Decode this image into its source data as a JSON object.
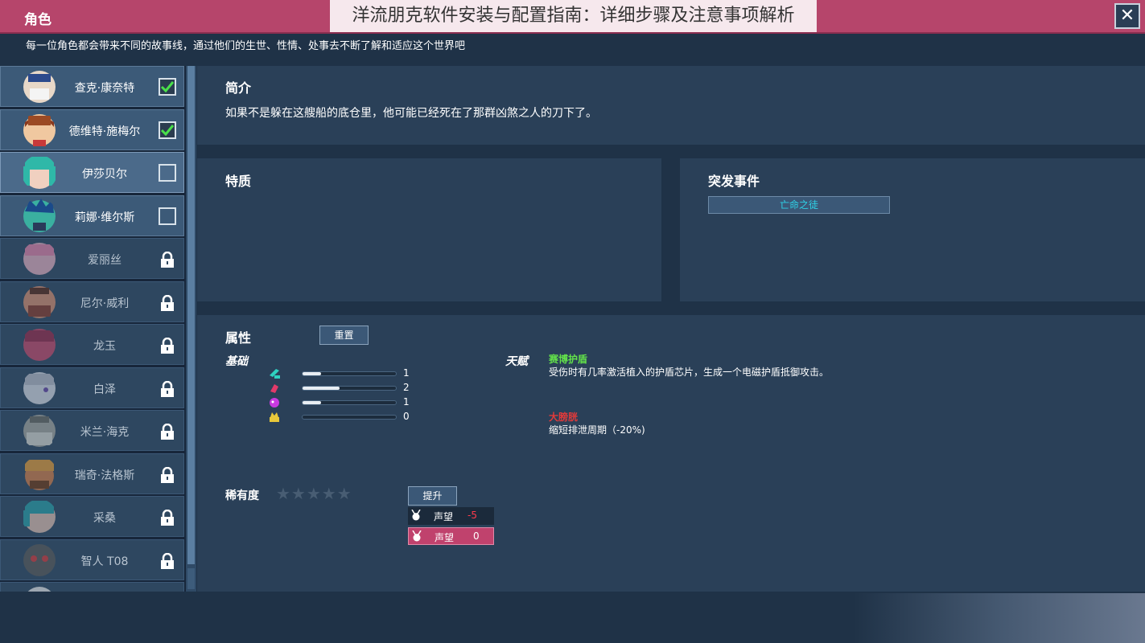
{
  "window": {
    "title": "角色",
    "overlay_banner": "洋流朋克软件安装与配置指南：详细步骤及注意事项解析",
    "close_label": "✕"
  },
  "subtitle": "每一位角色都会带来不同的故事线，通过他们的生世、性情、处事去不断了解和适应这个世界吧",
  "characters": [
    {
      "name": "查克·康奈特",
      "state": "checked"
    },
    {
      "name": "德维特·施梅尔",
      "state": "checked"
    },
    {
      "name": "伊莎贝尔",
      "state": "unchecked"
    },
    {
      "name": "莉娜·维尔斯",
      "state": "unchecked"
    },
    {
      "name": "爱丽丝",
      "state": "locked"
    },
    {
      "name": "尼尔·威利",
      "state": "locked"
    },
    {
      "name": "龙玉",
      "state": "locked"
    },
    {
      "name": "白泽",
      "state": "locked"
    },
    {
      "name": "米兰·海克",
      "state": "locked"
    },
    {
      "name": "瑞奇·法格斯",
      "state": "locked"
    },
    {
      "name": "采桑",
      "state": "locked"
    },
    {
      "name": "智人 T08",
      "state": "locked"
    }
  ],
  "intro": {
    "title": "简介",
    "text": "如果不是躲在这艘船的底仓里，他可能已经死在了那群凶煞之人的刀下了。"
  },
  "traits": {
    "title": "特质"
  },
  "events": {
    "title": "突发事件",
    "chip": "亡命之徒"
  },
  "attributes": {
    "title": "属性",
    "reset_label": "重置",
    "base_label": "基础",
    "stats": [
      {
        "icon": "agility-icon",
        "value": 1,
        "level": 0.2
      },
      {
        "icon": "strength-icon",
        "value": 2,
        "level": 0.4
      },
      {
        "icon": "intellect-icon",
        "value": 1,
        "level": 0.2
      },
      {
        "icon": "charisma-icon",
        "value": 0,
        "level": 0.0
      }
    ],
    "talent_label": "天赋",
    "talents": [
      {
        "name": "赛博护盾",
        "desc": "受伤时有几率激活植入的护盾芯片，生成一个电磁护盾抵御攻击。",
        "color": "#63e24a"
      },
      {
        "name": "大膀胱",
        "desc": "缩短排泄周期（-20%)",
        "color": "#e23a3a"
      }
    ],
    "rarity_label": "稀有度",
    "stars": "★★★★★",
    "upgrade_label": "提升",
    "reputation": [
      {
        "label": "声望",
        "value": "-5"
      },
      {
        "label": "声望",
        "value": "0"
      }
    ]
  },
  "colors": {
    "title_bar": "#b6456b",
    "background": "#1f3247",
    "panel": "#2a4058",
    "check": "#4ae04a",
    "event_text": "#2ed1e6"
  }
}
